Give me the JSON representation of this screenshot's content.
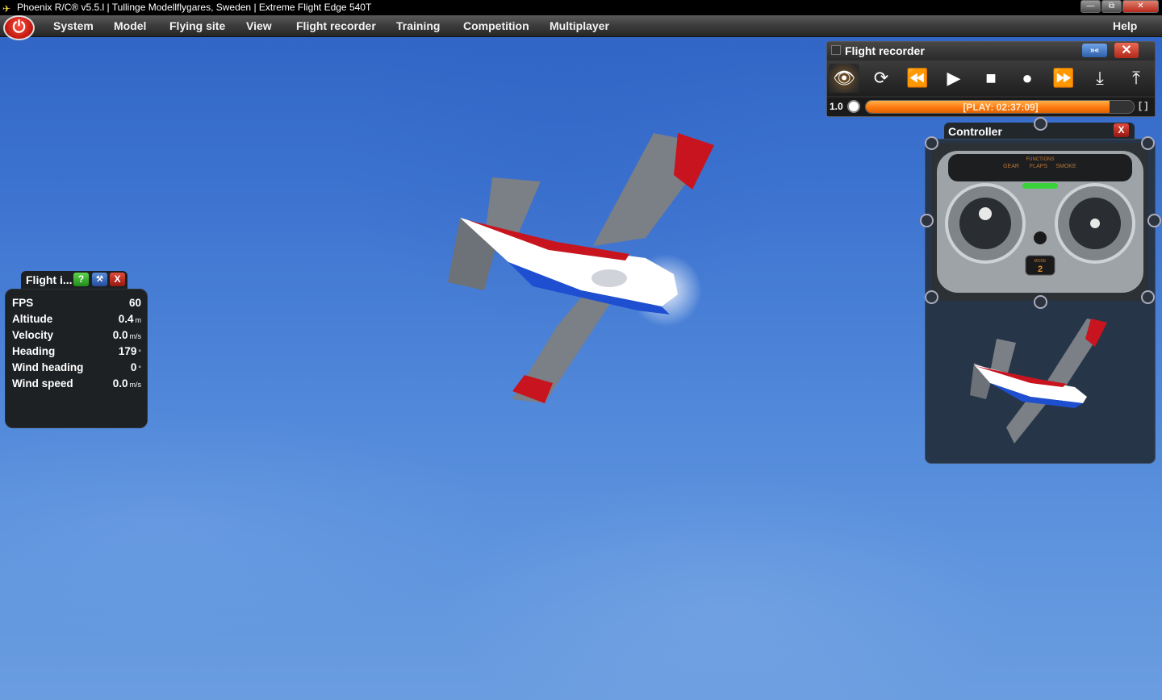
{
  "window": {
    "title": "Phoenix R/C® v5.5.l  |  Tullinge Modellflygares, Sweden  |  Extreme Flight Edge 540T",
    "minimize": "—",
    "restore": "⧉",
    "close": "✕"
  },
  "menu": {
    "power_icon": "power-icon",
    "power_glyph": "⏻",
    "items": [
      "System",
      "Model",
      "Flying site",
      "View",
      "Flight recorder",
      "Training",
      "Competition",
      "Multiplayer"
    ],
    "help": "Help"
  },
  "flight_info": {
    "title": "Flight i...",
    "help_btn": "?",
    "tools_btn": "⚒",
    "close_btn": "X",
    "rows": [
      {
        "label": "FPS",
        "value": "60",
        "unit": ""
      },
      {
        "label": "Altitude",
        "value": "0.4",
        "unit": "m"
      },
      {
        "label": "Velocity",
        "value": "0.0",
        "unit": "m/s"
      },
      {
        "label": "Heading",
        "value": "179",
        "unit": "°"
      },
      {
        "label": "Wind heading",
        "value": "0",
        "unit": "°"
      },
      {
        "label": "Wind speed",
        "value": "0.0",
        "unit": "m/s"
      }
    ]
  },
  "flight_recorder": {
    "title": "Flight recorder",
    "collapse": "»«",
    "close": "✕",
    "buttons": [
      {
        "name": "eye-icon",
        "glyph": "👁"
      },
      {
        "name": "loop-icon",
        "glyph": "⟳"
      },
      {
        "name": "rewind-icon",
        "glyph": "⏪"
      },
      {
        "name": "play-icon",
        "glyph": "▶"
      },
      {
        "name": "stop-icon",
        "glyph": "■"
      },
      {
        "name": "record-icon",
        "glyph": "●"
      },
      {
        "name": "fast-forward-icon",
        "glyph": "⏩"
      },
      {
        "name": "import-icon",
        "glyph": "⤓"
      },
      {
        "name": "export-icon",
        "glyph": "⤒"
      }
    ],
    "speed": "1.0",
    "status": "[PLAY: 02:37:09]",
    "progress": 0.91,
    "expand": "[ ]"
  },
  "controller": {
    "title": "Controller",
    "close": "X",
    "functions_label": "FUNCTIONS",
    "function_buttons": [
      "GEAR",
      "FLAPS",
      "SMOKE"
    ],
    "mode_label": "MODE",
    "mode_value": "2"
  },
  "colors": {
    "accent_orange": "#ff7d12",
    "aircraft_red": "#c8141e",
    "aircraft_blue": "#1f4fd1"
  }
}
